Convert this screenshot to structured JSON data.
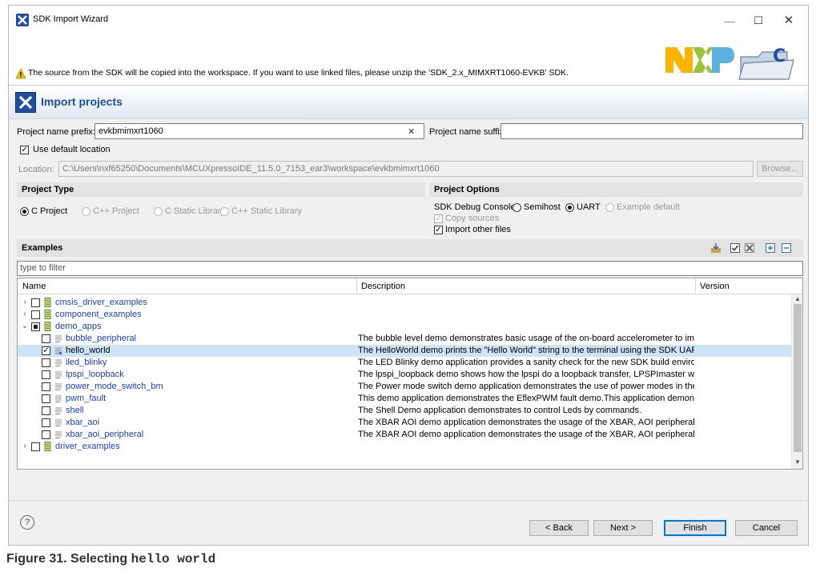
{
  "window": {
    "title": "SDK Import Wizard",
    "controls": {
      "minimize": "—",
      "maximize": "☐",
      "close": "✕"
    }
  },
  "banner": {
    "warning": "The source from the SDK will be copied into the workspace. If you want to use linked files, please unzip the 'SDK_2.x_MIMXRT1060-EVKB' SDK.",
    "logo_text": "NXP",
    "folder_label": "C"
  },
  "heading": {
    "title": "Import projects"
  },
  "naming": {
    "prefix_label": "Project name prefix:",
    "prefix_value": "evkbmimxrt1060",
    "clear_label": "✕",
    "suffix_label": "Project name suffix:",
    "suffix_value": ""
  },
  "location": {
    "use_default_label": "Use default location",
    "label": "Location:",
    "value": "C:\\Users\\nxf65250\\Documents\\MCUXpressoIDE_11.5.0_7153_ear3\\workspace\\evkbmimxrt1060",
    "browse_label": "Browse..."
  },
  "project_type": {
    "header": "Project Type",
    "options": [
      "C Project",
      "C++ Project",
      "C Static Library",
      "C++ Static Library"
    ],
    "selected": "C Project"
  },
  "project_options": {
    "header": "Project Options",
    "console_label": "SDK Debug Console",
    "console_options": [
      "Semihost",
      "UART",
      "Example default"
    ],
    "console_selected": "UART",
    "copy_sources": "Copy sources",
    "import_other": "Import other files"
  },
  "examples": {
    "header": "Examples",
    "filter_placeholder": "type to filter",
    "columns": {
      "name": "Name",
      "description": "Description",
      "version": "Version"
    },
    "rows": [
      {
        "name": "cmsis_driver_examples",
        "description": ""
      },
      {
        "name": "component_examples",
        "description": ""
      },
      {
        "name": "demo_apps",
        "description": ""
      },
      {
        "name": "bubble_peripheral",
        "description": "The bubble level demo demonstrates basic usage of the on-board accelerometer to im..."
      },
      {
        "name": "hello_world",
        "description": "The HelloWorld demo prints the \"Hello World\" string to the terminal using the SDK UAR..."
      },
      {
        "name": "iled_blinky",
        "description": "The LED Blinky demo application provides a sanity check for the new SDK build environ..."
      },
      {
        "name": "lpspi_loopback",
        "description": "The lpspi_loopback demo shows how the lpspi do a loopback transfer, LPSPImaster will ..."
      },
      {
        "name": "power_mode_switch_bm",
        "description": "The Power mode switch demo application demonstrates the use of power modes in the..."
      },
      {
        "name": "pwm_fault",
        "description": "This demo application demonstrates the EflexPWM fault demo.This application demon..."
      },
      {
        "name": "shell",
        "description": "The Shell Demo application demonstrates to control Leds by commands."
      },
      {
        "name": "xbar_aoi",
        "description": "The XBAR AOI demo application demonstrates the usage of the XBAR, AOI peripheral to..."
      },
      {
        "name": "xbar_aoi_peripheral",
        "description": "The XBAR AOI demo application demonstrates the usage of the XBAR, AOI peripheral to..."
      },
      {
        "name": "driver_examples",
        "description": ""
      }
    ]
  },
  "footer": {
    "help": "?",
    "back": "< Back",
    "next": "Next >",
    "finish": "Finish",
    "cancel": "Cancel"
  },
  "caption": {
    "prefix": "Figure 31.  Selecting ",
    "code": "hello world"
  }
}
